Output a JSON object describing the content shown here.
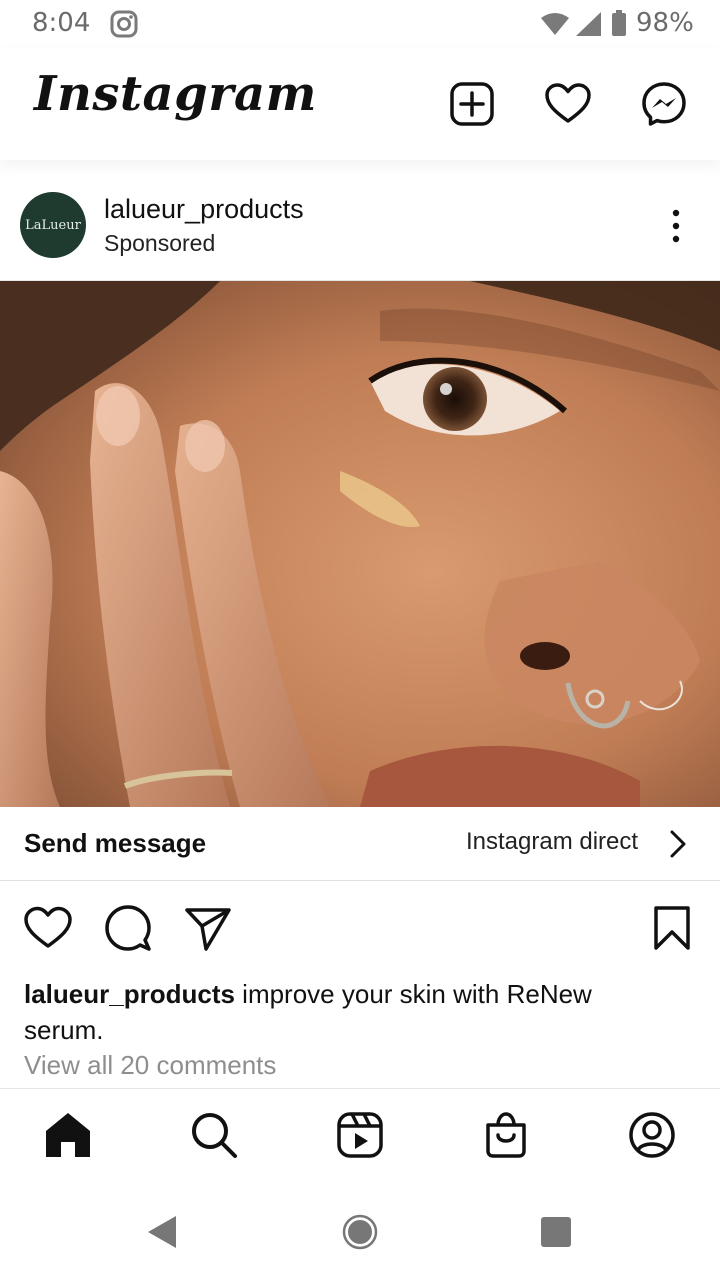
{
  "status_bar": {
    "time": "8:04",
    "battery": "98%"
  },
  "header": {
    "logo": "Instagram",
    "icons": [
      "plus-square-icon",
      "heart-icon",
      "messenger-icon"
    ]
  },
  "post": {
    "username": "lalueur_products",
    "label": "Sponsored",
    "avatar_text": "LaLueur",
    "cta": {
      "label": "Send message",
      "link": "Instagram direct"
    },
    "caption_user": "lalueur_products",
    "caption_text": " improve your skin with ReNew serum.",
    "view_comments": "View all 20 comments"
  },
  "bottom_nav": [
    "home-icon",
    "search-icon",
    "reels-icon",
    "shop-icon",
    "profile-icon"
  ],
  "colors": {
    "text": "#111111",
    "muted": "#8e8e8e",
    "avatar_bg": "#1f3a2f"
  }
}
